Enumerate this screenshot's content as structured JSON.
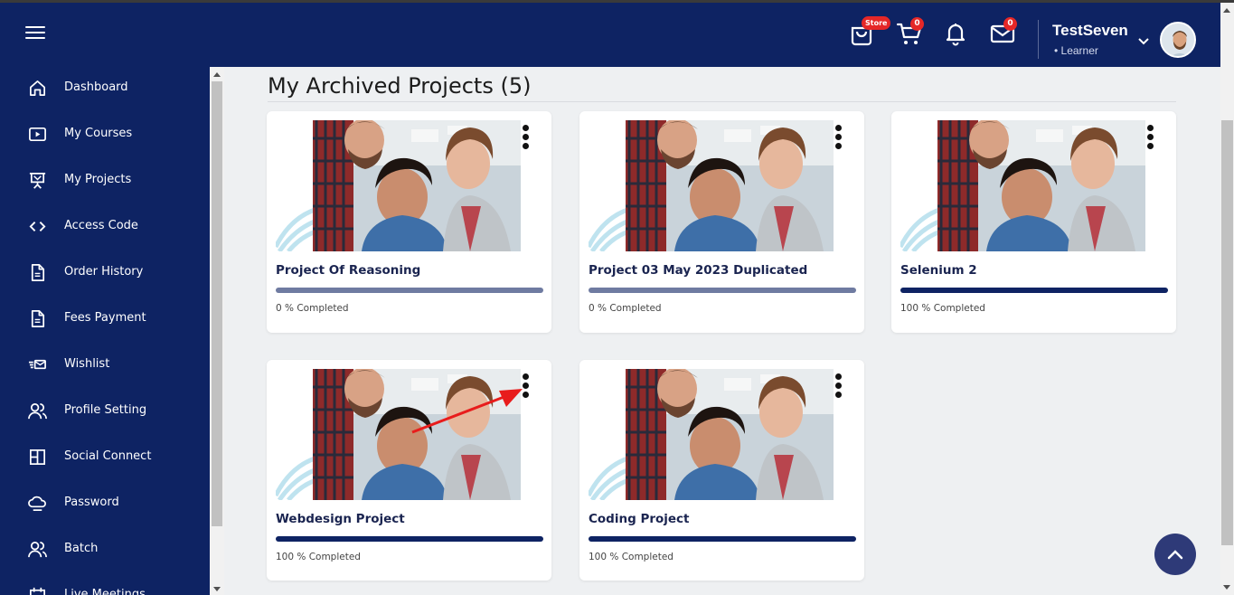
{
  "header": {
    "store_badge": "Store",
    "cart_count": "0",
    "mail_count": "0",
    "user_name": "TestSeven",
    "user_role": "• Learner",
    "bg_color": "#0e2363"
  },
  "sidebar": {
    "items": [
      {
        "label": "Dashboard",
        "icon": "home-icon"
      },
      {
        "label": "My Courses",
        "icon": "play-square-icon"
      },
      {
        "label": "My Projects",
        "icon": "presentation-icon"
      },
      {
        "label": "Access Code",
        "icon": "code-icon"
      },
      {
        "label": "Order History",
        "icon": "document-icon"
      },
      {
        "label": "Fees Payment",
        "icon": "document-icon"
      },
      {
        "label": "Wishlist",
        "icon": "wishlist-icon"
      },
      {
        "label": "Profile Setting",
        "icon": "users-icon"
      },
      {
        "label": "Social Connect",
        "icon": "layout-icon"
      },
      {
        "label": "Password",
        "icon": "cloud-lock-icon"
      },
      {
        "label": "Batch",
        "icon": "users-icon"
      },
      {
        "label": "Live Meetings",
        "icon": "calendar-icon"
      }
    ]
  },
  "main": {
    "title": "My Archived Projects (5)",
    "projects": [
      {
        "title": "Project Of Reasoning",
        "progress": 0,
        "progress_label": "0 % Completed"
      },
      {
        "title": "Project 03 May 2023 Duplicated",
        "progress": 0,
        "progress_label": "0 % Completed"
      },
      {
        "title": "Selenium 2",
        "progress": 100,
        "progress_label": "100 % Completed"
      },
      {
        "title": "Webdesign Project",
        "progress": 100,
        "progress_label": "100 % Completed"
      },
      {
        "title": "Coding Project",
        "progress": 100,
        "progress_label": "100 % Completed"
      }
    ]
  },
  "colors": {
    "accent": "#0e2363",
    "badge": "#e52727",
    "annotation_arrow": "#e81c1c"
  }
}
